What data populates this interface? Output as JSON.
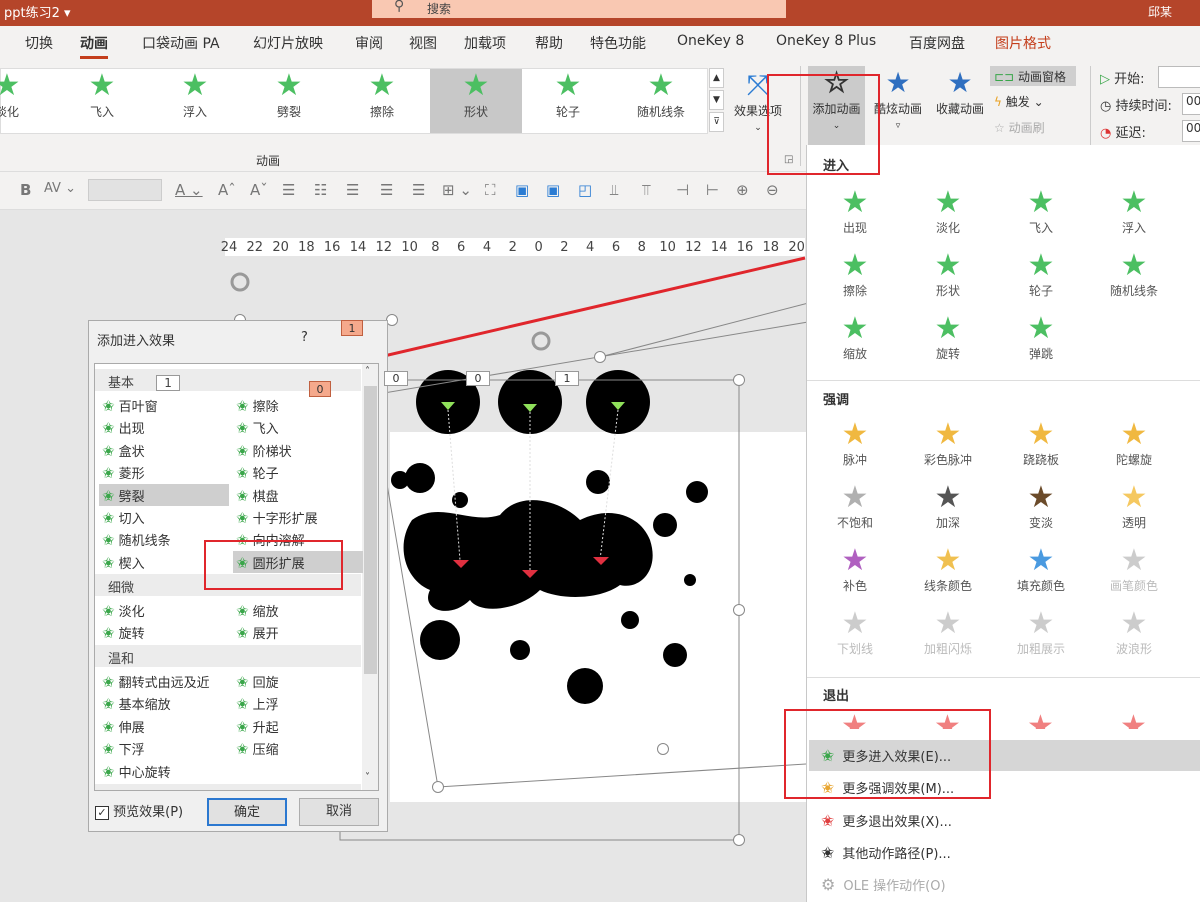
{
  "titlebar": {
    "doc_title": "ppt练习2 ▾",
    "search": "搜索",
    "user": "邱某"
  },
  "tabs": [
    {
      "label": "切换"
    },
    {
      "label": "动画",
      "active": true
    },
    {
      "label": "口袋动画 PA"
    },
    {
      "label": "幻灯片放映"
    },
    {
      "label": "审阅"
    },
    {
      "label": "视图"
    },
    {
      "label": "加载项"
    },
    {
      "label": "帮助"
    },
    {
      "label": "特色功能"
    },
    {
      "label": "OneKey 8"
    },
    {
      "label": "OneKey 8 Plus"
    },
    {
      "label": "百度网盘"
    },
    {
      "label": "图片格式",
      "red": true
    }
  ],
  "gallery": {
    "items": [
      {
        "label": "淡化"
      },
      {
        "label": "飞入"
      },
      {
        "label": "浮入"
      },
      {
        "label": "劈裂"
      },
      {
        "label": "擦除"
      },
      {
        "label": "形状",
        "selected": true
      },
      {
        "label": "轮子"
      },
      {
        "label": "随机线条"
      }
    ],
    "group_label": "动画"
  },
  "ribbon": {
    "effect_options": "效果选项",
    "add_animation": "添加动画",
    "cool_animation": "酷炫动画",
    "fav_animation": "收藏动画",
    "animation_pane": "动画窗格",
    "trigger": "触发",
    "animation_painter": "动画刷",
    "start": "开始:",
    "duration": "持续时间:",
    "delay": "延迟:",
    "duration_value": "00",
    "delay_value": "00"
  },
  "ruler": [
    "24",
    "22",
    "20",
    "18",
    "16",
    "14",
    "12",
    "10",
    "8",
    "6",
    "4",
    "2",
    "0",
    "2",
    "4",
    "6",
    "8",
    "10",
    "12",
    "14",
    "16",
    "18",
    "20"
  ],
  "canvas_badges": {
    "dialog_badge_1": "1",
    "dialog_badge_0": "0",
    "marker_a": "0",
    "marker_b": "0",
    "marker_c": "1"
  },
  "dialog": {
    "title": "添加进入效果",
    "help": "?",
    "categories": [
      {
        "name": "基本",
        "badge": "1",
        "items": [
          "百叶窗",
          "擦除",
          "出现",
          "飞入",
          "盒状",
          "阶梯状",
          "菱形",
          "轮子",
          "劈裂",
          "棋盘",
          "切入",
          "十字形扩展",
          "随机线条",
          "向内溶解",
          "楔入",
          "圆形扩展"
        ]
      },
      {
        "name": "细微",
        "items": [
          "淡化",
          "缩放",
          "旋转",
          "展开"
        ]
      },
      {
        "name": "温和",
        "items": [
          "翻转式由远及近",
          "回旋",
          "基本缩放",
          "上浮",
          "伸展",
          "升起",
          "下浮",
          "压缩",
          "中心旋转"
        ]
      }
    ],
    "selected": [
      "劈裂",
      "圆形扩展"
    ],
    "preview_label": "预览效果(P)",
    "preview_checked": true,
    "ok": "确定",
    "cancel": "取消"
  },
  "panel": {
    "enter": {
      "title": "进入",
      "items": [
        {
          "label": "出现"
        },
        {
          "label": "淡化"
        },
        {
          "label": "飞入"
        },
        {
          "label": "浮入"
        },
        {
          "label": "擦除"
        },
        {
          "label": "形状"
        },
        {
          "label": "轮子"
        },
        {
          "label": "随机线条"
        },
        {
          "label": "缩放"
        },
        {
          "label": "旋转"
        },
        {
          "label": "弹跳"
        }
      ]
    },
    "emphasis": {
      "title": "强调",
      "items": [
        {
          "label": "脉冲"
        },
        {
          "label": "彩色脉冲"
        },
        {
          "label": "跷跷板"
        },
        {
          "label": "陀螺旋"
        },
        {
          "label": "不饱和"
        },
        {
          "label": "加深"
        },
        {
          "label": "变淡"
        },
        {
          "label": "透明"
        },
        {
          "label": "补色"
        },
        {
          "label": "线条颜色"
        },
        {
          "label": "填充颜色"
        },
        {
          "label": "画笔颜色",
          "disabled": true
        },
        {
          "label": "下划线",
          "disabled": true
        },
        {
          "label": "加粗闪烁",
          "disabled": true
        },
        {
          "label": "加粗展示",
          "disabled": true
        },
        {
          "label": "波浪形",
          "disabled": true
        }
      ]
    },
    "exit": {
      "title": "退出"
    },
    "menu": [
      {
        "label": "更多进入效果(E)...",
        "color": "#3aa64a",
        "hl": true
      },
      {
        "label": "更多强调效果(M)...",
        "color": "#e8a530"
      },
      {
        "label": "更多退出效果(X)...",
        "color": "#e04040"
      },
      {
        "label": "其他动作路径(P)...",
        "color": "#333"
      },
      {
        "label": "OLE 操作动作(O)",
        "color": "#aaa",
        "disabled": true
      }
    ]
  },
  "colors": {
    "brand": "#b5452a",
    "accent_red": "#c43e1c",
    "enter_green": "#3aa64a",
    "emphasis_gold": "#e8b040",
    "exit_red": "#e04040",
    "annotation_red": "#e0262c"
  }
}
